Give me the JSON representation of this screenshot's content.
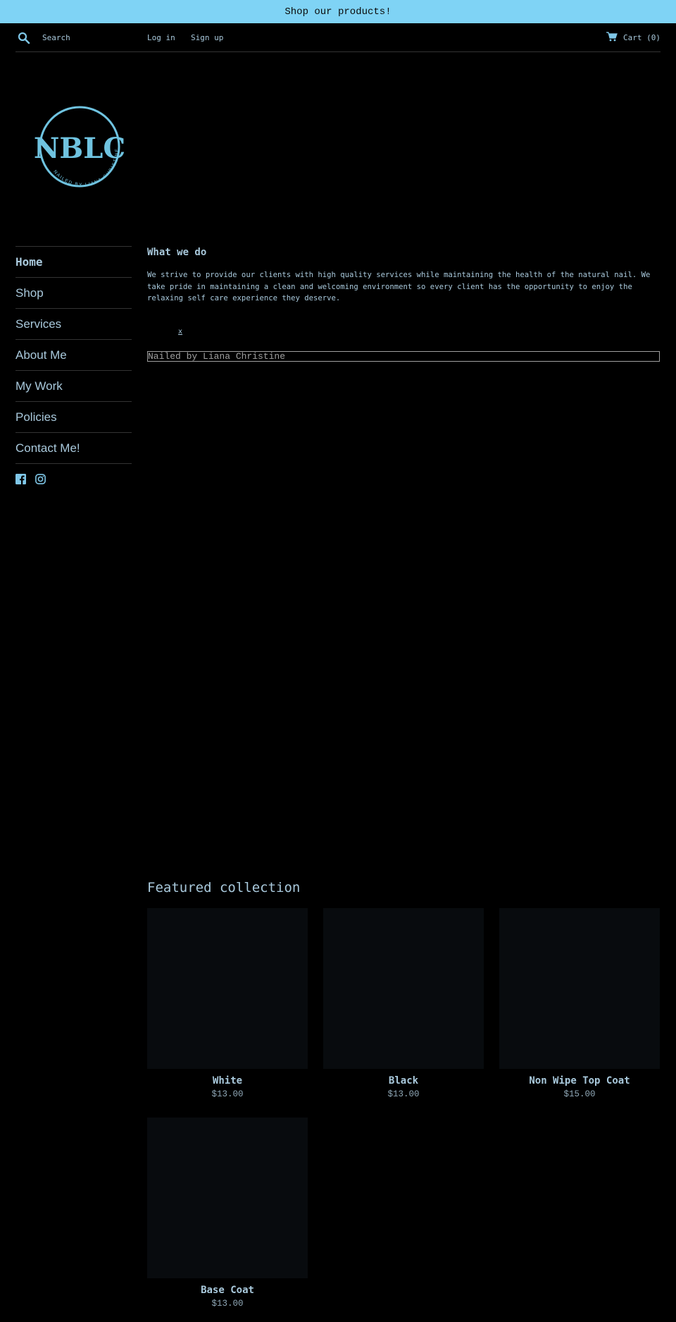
{
  "announcement": "Shop our products!",
  "header": {
    "search_placeholder": "Search",
    "login_label": "Log in",
    "signup_label": "Sign up",
    "cart_label": "Cart (0)"
  },
  "logo": {
    "monogram": "NBLC",
    "tagline": "NAILED BY LIANA CHRISTINE"
  },
  "sidebar": {
    "items": [
      {
        "label": "Home"
      },
      {
        "label": "Shop"
      },
      {
        "label": "Services"
      },
      {
        "label": "About Me"
      },
      {
        "label": "My Work"
      },
      {
        "label": "Policies"
      },
      {
        "label": "Contact Me!"
      }
    ],
    "social": [
      "facebook-icon",
      "instagram-icon"
    ]
  },
  "main": {
    "heading": "What we do",
    "text": "We strive to provide our clients with high quality services while maintaining the health of the natural nail. We take pride in maintaining a clean and welcoming environment so every client has the opportunity to enjoy the relaxing self care experience they deserve.",
    "close_mark": "x",
    "embed_text": "Nailed by Liana Christine"
  },
  "featured": {
    "title": "Featured collection",
    "products": [
      {
        "name": "White",
        "price": "$13.00"
      },
      {
        "name": "Black",
        "price": "$13.00"
      },
      {
        "name": "Non Wipe Top Coat",
        "price": "$15.00"
      },
      {
        "name": "Base Coat",
        "price": "$13.00"
      }
    ]
  },
  "colors": {
    "background": "#000000",
    "announcement_bg": "#7fd3f5",
    "accent": "#a9c9dc",
    "logo_ring": "#6fc3e0"
  }
}
